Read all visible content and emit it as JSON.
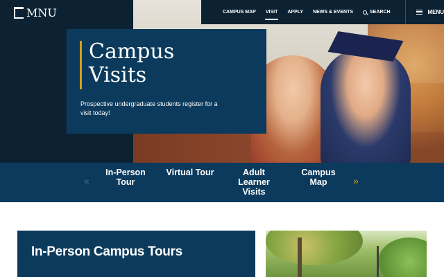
{
  "header": {
    "logo_text": "MNU",
    "nav": [
      {
        "label": "CAMPUS MAP",
        "active": false
      },
      {
        "label": "VISIT",
        "active": true
      },
      {
        "label": "APPLY",
        "active": false
      },
      {
        "label": "NEWS & EVENTS",
        "active": false
      },
      {
        "label": "SEARCH",
        "active": false,
        "icon": "search-icon"
      }
    ],
    "menu_label": "MENU",
    "menu_icon": "hamburger-icon"
  },
  "hero": {
    "title_line1": "Campus",
    "title_line2": "Visits",
    "description": "Prospective undergraduate students register for a visit today!",
    "photo_alt": "Two smiling students, one wearing a graduation cap and gown"
  },
  "subnav": {
    "prev_icon": "«",
    "next_icon": "»",
    "tabs": [
      {
        "line1": "In-Person",
        "line2": "Tour",
        "line3": ""
      },
      {
        "line1": "Virtual Tour",
        "line2": "",
        "line3": ""
      },
      {
        "line1": "Adult",
        "line2": "Learner",
        "line3": "Visits"
      },
      {
        "line1": "Campus",
        "line2": "Map",
        "line3": ""
      }
    ]
  },
  "section": {
    "title": "In-Person Campus Tours"
  },
  "colors": {
    "navy_dark": "#0c2233",
    "navy": "#0b3a5c",
    "gold": "#d4a017",
    "white": "#ffffff"
  }
}
